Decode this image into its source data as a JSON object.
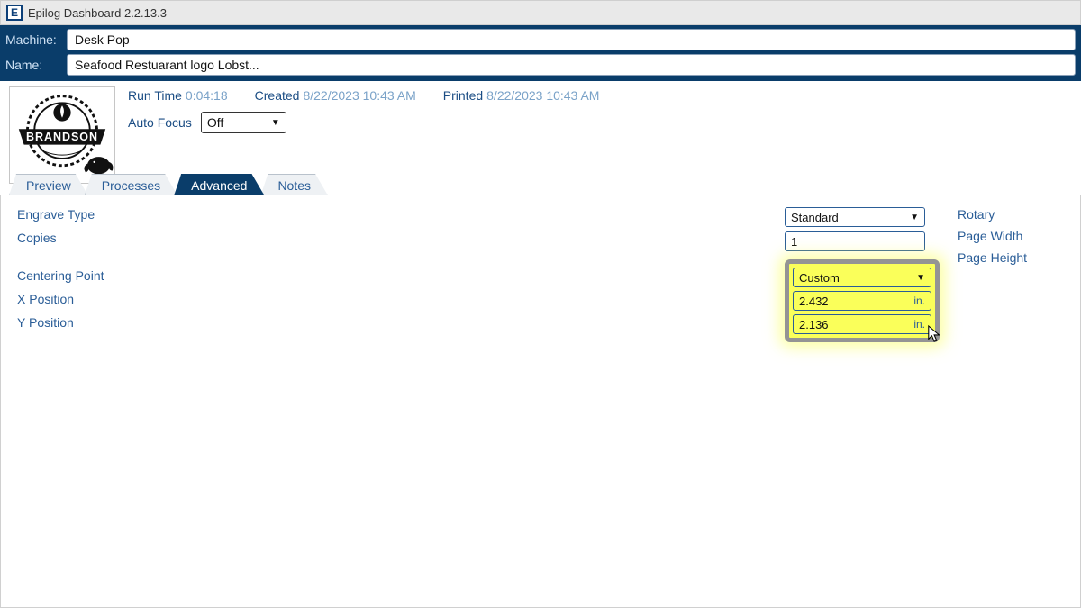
{
  "titlebar": {
    "text": "Epilog Dashboard 2.2.13.3",
    "icon_letter": "E"
  },
  "header": {
    "machine_label": "Machine:",
    "machine_value": "Desk Pop",
    "name_label": "Name:",
    "name_value": "Seafood Restuarant logo Lobst..."
  },
  "info": {
    "run_time_label": "Run Time",
    "run_time_value": "0:04:18",
    "created_label": "Created",
    "created_value": "8/22/2023 10:43 AM",
    "printed_label": "Printed",
    "printed_value": "8/22/2023 10:43 AM",
    "autofocus_label": "Auto Focus",
    "autofocus_value": "Off"
  },
  "tabs": {
    "preview": "Preview",
    "processes": "Processes",
    "advanced": "Advanced",
    "notes": "Notes"
  },
  "advanced": {
    "engrave_type_label": "Engrave Type",
    "engrave_type_value": "Standard",
    "copies_label": "Copies",
    "copies_value": "1",
    "centering_label": "Centering Point",
    "centering_value": "Custom",
    "x_label": "X Position",
    "x_value": "2.432",
    "x_unit": "in.",
    "y_label": "Y Position",
    "y_value": "2.136",
    "y_unit": "in.",
    "rotary_label": "Rotary",
    "page_width_label": "Page Width",
    "page_height_label": "Page Height"
  },
  "logo_text": "BRANDSON"
}
